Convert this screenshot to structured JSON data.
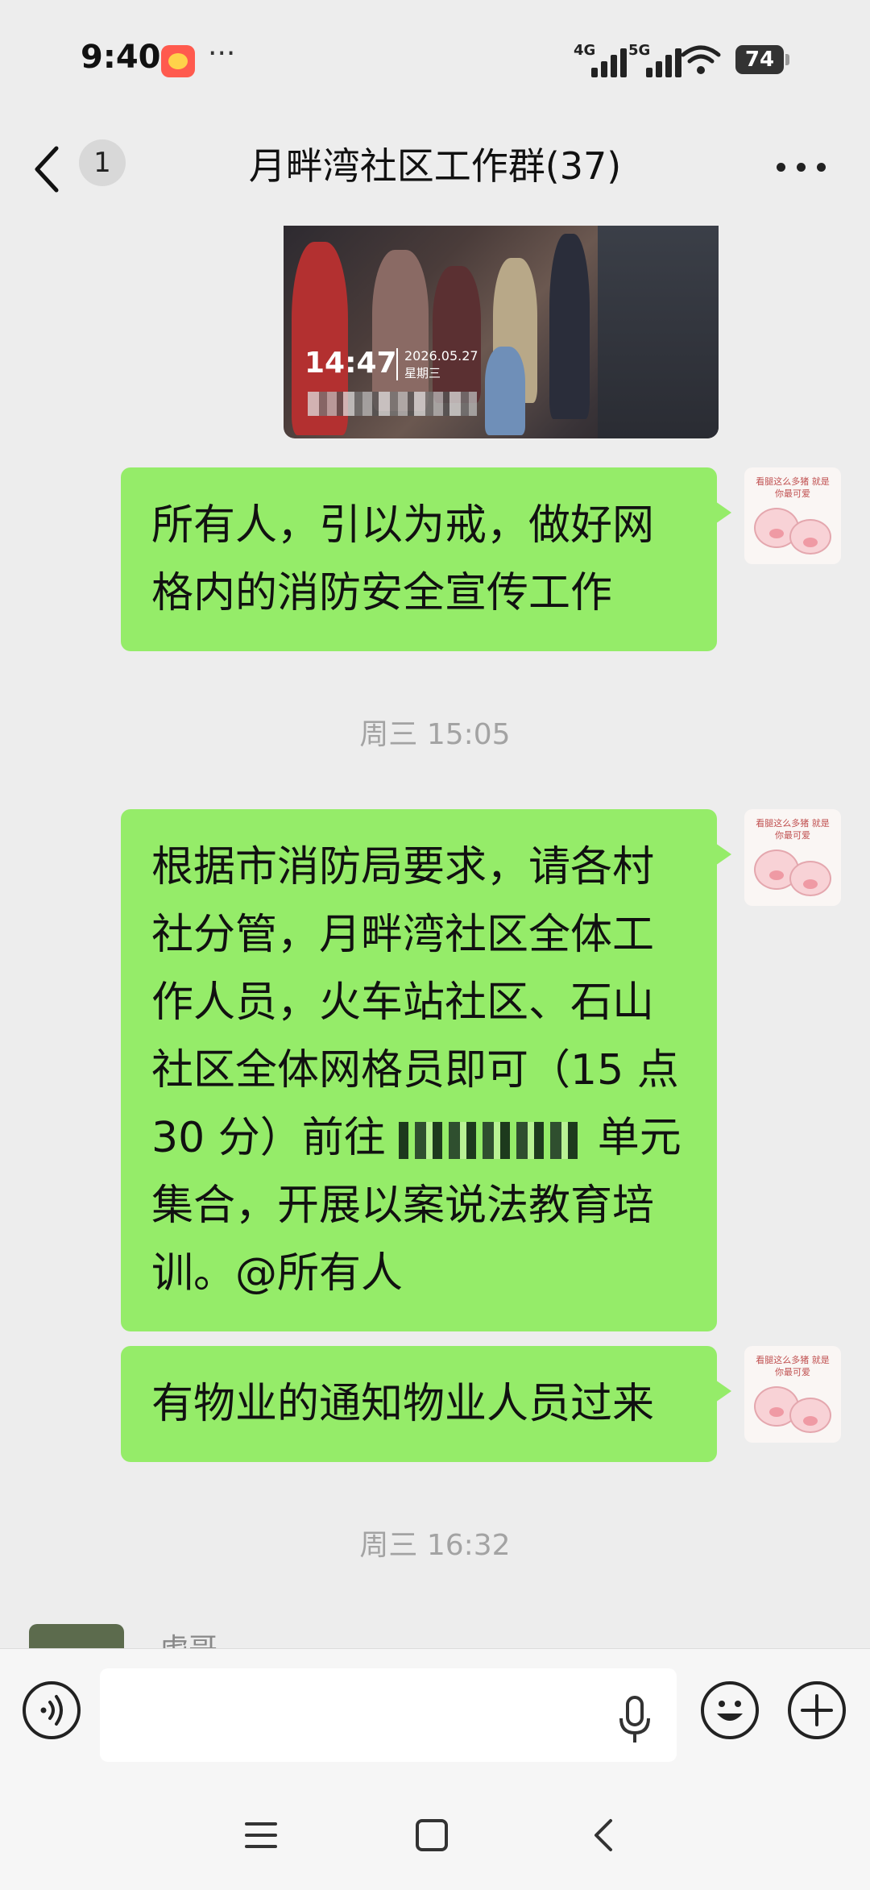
{
  "status_bar": {
    "time": "9:40",
    "more": "···",
    "network_1": "4G",
    "network_2": "5G",
    "battery": "74"
  },
  "header": {
    "unread_count": "1",
    "title": "月畔湾社区工作群(37)"
  },
  "video_message": {
    "time": "14:47",
    "date": "2026.05.27",
    "weekday": "星期三"
  },
  "messages": [
    {
      "text": "所有人，引以为戒，做好网格内的消防安全宣传工作"
    },
    {
      "text": "根据市消防局要求，请各村社分管，月畔湾社区全体工作人员，火车站社区、石山社区全体网格员即可（15 点 30 分）前往"
    },
    {
      "text_after_redaction": "单元集合，开展以案说法教育培训。@所有人"
    },
    {
      "text": "有物业的通知物业人员过来"
    }
  ],
  "timestamps": {
    "t1": "周三 15:05",
    "t2": "周三 16:32"
  },
  "partial_sender": "虎哥",
  "avatar_caption": "看腿这么多猪 就是你最可爱",
  "input": {
    "value": "",
    "placeholder": ""
  }
}
